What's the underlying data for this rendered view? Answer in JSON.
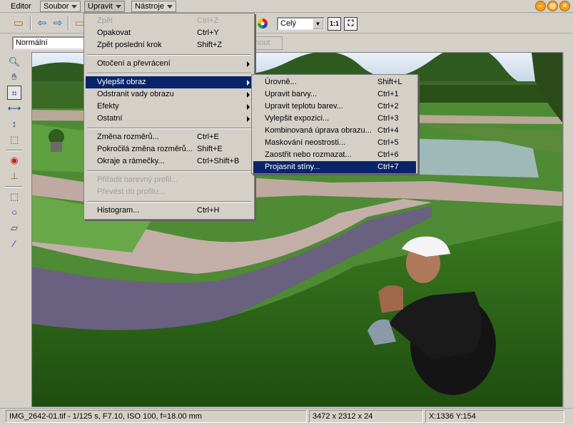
{
  "menubar": {
    "editor": "Editor",
    "soubor": "Soubor",
    "upravit": "Upravit",
    "nastroje": "Nástroje"
  },
  "toolbar": {
    "zoom_value": "Celý",
    "one_to_one": "1:1",
    "mode_value": "Normální",
    "ghost_button": "nout"
  },
  "upravit_menu": {
    "items": [
      {
        "label": "Zpět",
        "shortcut": "Ctrl+Z",
        "disabled": true
      },
      {
        "label": "Opakovat",
        "shortcut": "Ctrl+Y"
      },
      {
        "label": "Zpět poslední krok",
        "shortcut": "Shift+Z"
      },
      {
        "label": "Otočení a převrácení",
        "submenu": true
      },
      {
        "label": "Vylepšit obraz",
        "submenu": true,
        "highlighted": true
      },
      {
        "label": "Odstranit vady obrazu",
        "submenu": true
      },
      {
        "label": "Efekty",
        "submenu": true
      },
      {
        "label": "Ostatní",
        "submenu": true
      },
      {
        "label": "Změna rozměrů...",
        "shortcut": "Ctrl+E"
      },
      {
        "label": "Pokročilá změna rozměrů...",
        "shortcut": "Shift+E"
      },
      {
        "label": "Okraje a rámečky...",
        "shortcut": "Ctrl+Shift+B"
      },
      {
        "label": "Přiřadit barevný profil...",
        "disabled": true
      },
      {
        "label": "Převést do profilu...",
        "disabled": true
      },
      {
        "label": "Histogram...",
        "shortcut": "Ctrl+H"
      }
    ]
  },
  "vylepsit_submenu": {
    "items": [
      {
        "label": "Úrovně...",
        "shortcut": "Shift+L"
      },
      {
        "label": "Upravit barvy...",
        "shortcut": "Ctrl+1"
      },
      {
        "label": "Upravit teplotu barev...",
        "shortcut": "Ctrl+2"
      },
      {
        "label": "Vylepšit expozici...",
        "shortcut": "Ctrl+3"
      },
      {
        "label": "Kombinovaná úprava obrazu...",
        "shortcut": "Ctrl+4"
      },
      {
        "label": "Maskování neostrosti...",
        "shortcut": "Ctrl+5"
      },
      {
        "label": "Zaostřit nebo rozmazat...",
        "shortcut": "Ctrl+6"
      },
      {
        "label": "Projasnit stíny...",
        "shortcut": "Ctrl+7",
        "highlighted": true
      }
    ]
  },
  "status": {
    "file_info": "IMG_2642-01.tif - 1/125 s, F7.10, ISO 100, f=18.00 mm",
    "dimensions": "3472 x 2312 x 24",
    "coords": "X:1336  Y:154"
  },
  "colors": {
    "highlight": "#0a246a",
    "chrome": "#d4d0c8"
  }
}
